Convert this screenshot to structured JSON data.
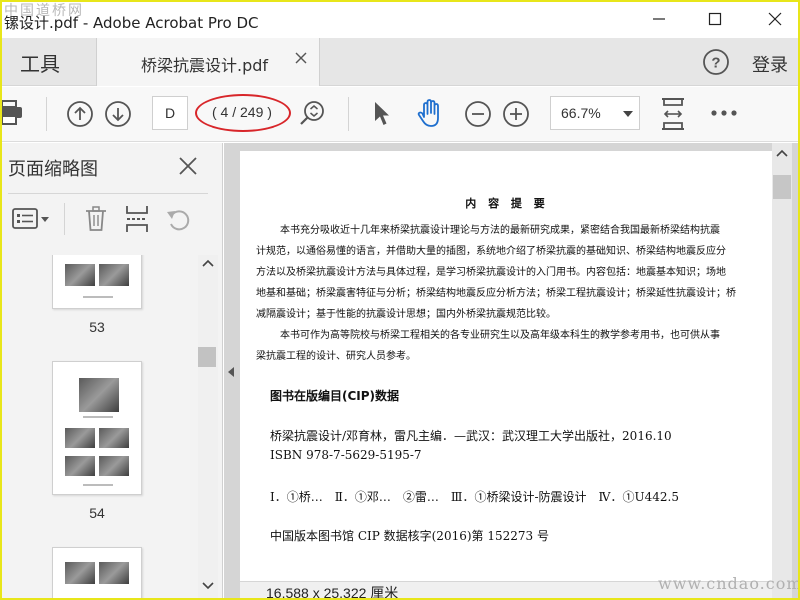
{
  "window": {
    "title": "镙设计.pdf - Adobe Acrobat Pro DC",
    "watermark_top": "中国道桥网",
    "watermark_bottom": "www.cndao.com"
  },
  "tabs": {
    "tools_label": "工具",
    "document_label": "桥梁抗震设计.pdf",
    "login_label": "登录"
  },
  "toolbar": {
    "page_input_value": "D",
    "page_count": "( 4 / 249 )",
    "zoom_value": "66.7%"
  },
  "sidebar": {
    "title": "页面缩略图",
    "thumbnails": [
      {
        "page": "53"
      },
      {
        "page": "54"
      },
      {
        "page": ""
      }
    ]
  },
  "document": {
    "heading": "内 容 提 要",
    "paragraph1": [
      "本书充分吸收近十几年来桥梁抗震设计理论与方法的最新研究成果，紧密结合我国最新桥梁结构抗震",
      "计规范，以通俗易懂的语言，并借助大量的插图，系统地介绍了桥梁抗震的基础知识、桥梁结构地震反应分",
      "方法以及桥梁抗震设计方法与具体过程，是学习桥梁抗震设计的入门用书。内容包括：地震基本知识；场地",
      "地基和基础；桥梁震害特征与分析；桥梁结构地震反应分析方法；桥梁工程抗震设计；桥梁延性抗震设计；桥",
      "减隔震设计；基于性能的抗震设计思想；国内外桥梁抗震规范比较。"
    ],
    "paragraph2": [
      "本书可作为高等院校与桥梁工程相关的各专业研究生以及高年级本科生的教学参考用书，也可供从事",
      "梁抗震工程的设计、研究人员参考。"
    ],
    "cip_heading": "图书在版编目(CIP)数据",
    "cip_lines": [
      "桥梁抗震设计/邓育林，雷凡主编．—武汉：武汉理工大学出版社，2016.10",
      "ISBN 978-7-5629-5195-7",
      "Ⅰ．①桥…　Ⅱ．①邓…　②雷…　Ⅲ．①桥梁设计-防震设计　Ⅳ．①U442.5",
      "中国版本图书馆 CIP 数据核字(2016)第 152273 号"
    ]
  },
  "status": {
    "page_size": "16.588 x 25.322 厘米"
  }
}
